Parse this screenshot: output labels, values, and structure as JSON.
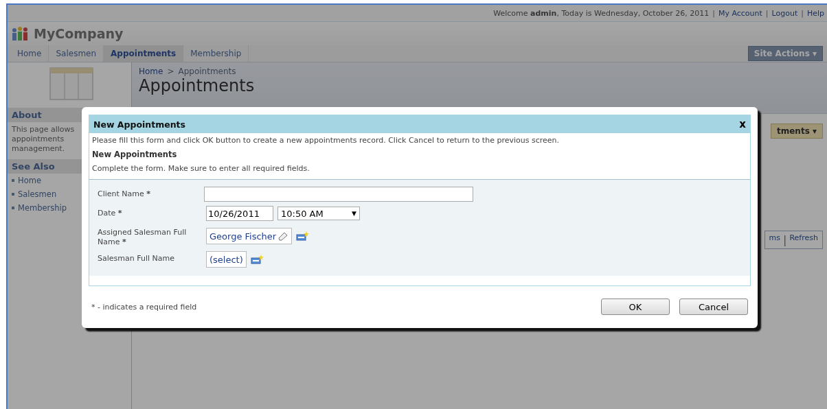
{
  "header": {
    "welcome": "Welcome **admin**, Today is Wednesday, October 26, 2011",
    "links": [
      "My Account",
      "Logout",
      "Help"
    ],
    "separator": "|"
  },
  "logo": {
    "name": "MyCompany"
  },
  "tabs": [
    {
      "label": "Home",
      "selected": false
    },
    {
      "label": "Salesmen",
      "selected": false
    },
    {
      "label": "Appointments",
      "selected": true
    },
    {
      "label": "Membership",
      "selected": false
    }
  ],
  "site_actions": {
    "label": "Site Actions",
    "caret": "▾"
  },
  "breadcrumb": {
    "items": [
      "Home",
      "Appointments"
    ],
    "separator": ">"
  },
  "page_title": "Appointments",
  "sidebar": {
    "about_title": "About",
    "about_text": "This page allows appointments management.",
    "see_also_title": "See Also",
    "links": [
      "Home",
      "Salesmen",
      "Membership"
    ]
  },
  "background_controls": {
    "menu_button": "tments",
    "menu_caret": "▾",
    "links": [
      "ms",
      "Refresh"
    ],
    "separator": "|"
  },
  "dialog": {
    "title": "New Appointments",
    "close": "x",
    "instructions": "Please fill this form and click OK button to create a new appointments record. Click Cancel to return to the previous screen.",
    "section_title": "New Appointments",
    "section_hint": "Complete the form. Make sure to enter all required fields.",
    "required_mark": "*",
    "fields": [
      {
        "kind": "text",
        "label": "Client Name",
        "required": true
      },
      {
        "kind": "datetime",
        "label": "Date",
        "required": true,
        "date": "10/26/2011",
        "time": "10:50 AM",
        "caret": "▼"
      },
      {
        "kind": "lookup",
        "label": "Assigned Salesman Full Name",
        "required": true,
        "value": "George Fischer",
        "clearable": true
      },
      {
        "kind": "lookup",
        "label": "Salesman Full Name",
        "required": false,
        "value": "(select)",
        "clearable": false
      }
    ],
    "footer_note": "* - indicates a required field",
    "buttons": [
      "OK",
      "Cancel"
    ]
  }
}
